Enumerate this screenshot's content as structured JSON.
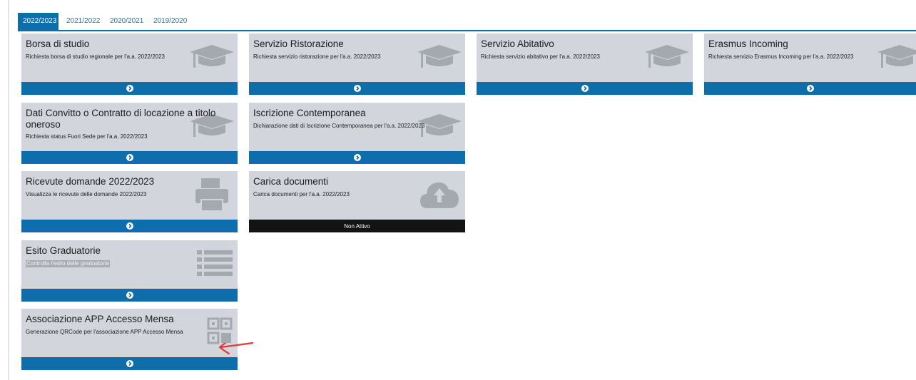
{
  "tabs": [
    {
      "label": "2022/2023",
      "active": true
    },
    {
      "label": "2021/2022",
      "active": false
    },
    {
      "label": "2020/2021",
      "active": false
    },
    {
      "label": "2019/2020",
      "active": false
    }
  ],
  "cards": [
    {
      "title": "Borsa di studio",
      "description": "Richiesta borsa di studio regionale per l'a.a. 2022/2023",
      "icon": "graduation-cap-icon",
      "status": "active"
    },
    {
      "title": "Servizio Ristorazione",
      "description": "Richiesta servizio ristorazione per l'a.a. 2022/2023",
      "icon": "graduation-cap-icon",
      "status": "active"
    },
    {
      "title": "Servizio Abitativo",
      "description": "Richiesta servizio abitativo per l'a.a. 2022/2023",
      "icon": "graduation-cap-icon",
      "status": "active"
    },
    {
      "title": "Erasmus Incoming",
      "description": "Richiesta servizio Erasmus Incoming per l'a.a. 2022/2023",
      "icon": "graduation-cap-icon",
      "status": "active"
    },
    {
      "title": "Dati Convitto o Contratto di locazione a titolo oneroso",
      "description": "Richiesta status Fuori Sede per l'a.a. 2022/2023",
      "icon": "graduation-cap-icon",
      "status": "active"
    },
    {
      "title": "Iscrizione Contemporanea",
      "description": "Dichiarazione dati di Iscrizione Contemporanea per l'a.a. 2022/2023",
      "icon": "graduation-cap-icon",
      "status": "active"
    },
    {
      "title": "Ricevute domande 2022/2023",
      "description": "Visualizza le ricevute delle domande 2022/2023",
      "icon": "printer-icon",
      "status": "active"
    },
    {
      "title": "Carica documenti",
      "description": "Carica documenti per l'a.a. 2022/2023",
      "icon": "cloud-upload-icon",
      "status": "inactive",
      "footer_label": "Non Attivo"
    },
    {
      "title": "Esito Graduatorie",
      "description": "Controlla l'esito delle graduatorie",
      "icon": "list-icon",
      "status": "active"
    },
    {
      "title": "Associazione APP Accesso Mensa",
      "description": "Generazione QRCode per l'associazione APP Accesso Mensa",
      "icon": "qr-code-icon",
      "status": "active"
    }
  ],
  "colors": {
    "accent": "#0d6eab",
    "card_background": "#d2d5dc",
    "icon_color": "#a4a8af",
    "inactive_footer": "#131313",
    "annotation": "#e5383b"
  },
  "footer_icon": "arrow-circle-right-icon",
  "annotation_icon": "hand-drawn-arrow-icon"
}
